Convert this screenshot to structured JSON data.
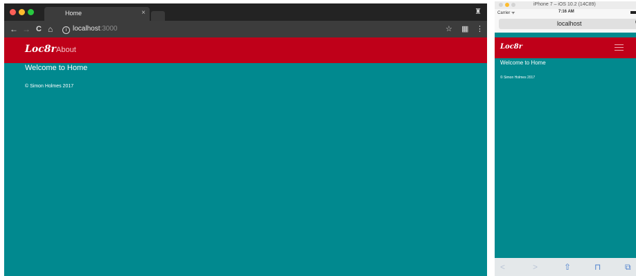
{
  "desktop": {
    "tab": {
      "title": "Home",
      "close": "×"
    },
    "toolbar": {
      "back": "←",
      "forward": "→",
      "reload": "C",
      "home": "⌂",
      "info": "i",
      "url_host": "localhost",
      "url_port": ":3000",
      "bookmark": "☆",
      "menu": "⋮"
    },
    "site": {
      "brand": "Loc8r",
      "nav_about": "About",
      "heading": "Welcome to Home",
      "footer": "© Simon Holmes 2017"
    },
    "colors": {
      "navbar": "#bf0019",
      "page_bg": "#01898f"
    }
  },
  "phone": {
    "simulator_title": "iPhone 7 – iOS 10.2 (14C89)",
    "status": {
      "carrier": "Carrier ᯤ",
      "time": "7:16 AM"
    },
    "address": "localhost",
    "reload": "C",
    "site": {
      "brand": "Loc8r",
      "heading": "Welcome to Home",
      "footer": "© Simon Holmes 2017"
    },
    "toolbar": {
      "back": "<",
      "forward": ">",
      "share": "⇧",
      "bookmarks": "⊓",
      "tabs": "⧉"
    }
  }
}
